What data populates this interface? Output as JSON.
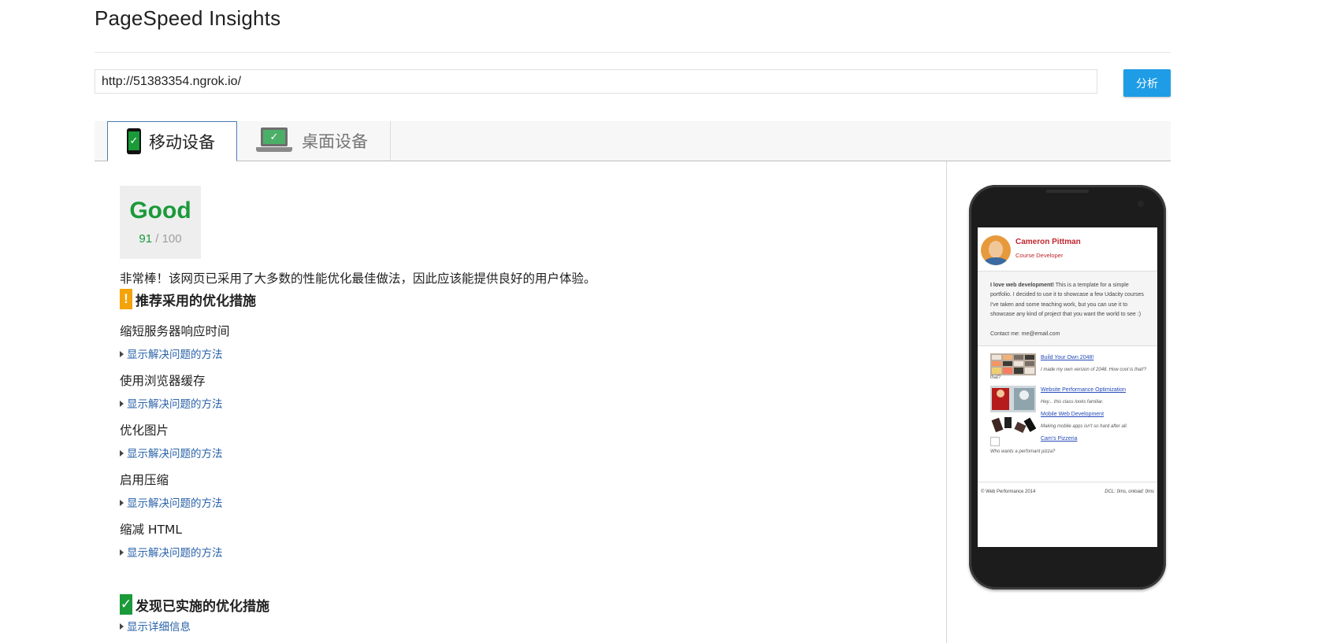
{
  "app": {
    "title": "PageSpeed Insights"
  },
  "search": {
    "value": "http://51383354.ngrok.io/",
    "button_label": "分析"
  },
  "tabs": [
    {
      "label": "移动设备",
      "icon": "phone-check-icon",
      "active": true
    },
    {
      "label": "桌面设备",
      "icon": "laptop-check-icon",
      "active": false
    }
  ],
  "score": {
    "label": "Good",
    "value": "91",
    "separator": " / ",
    "max": "100",
    "color": "#1a9a39"
  },
  "summary": "非常棒！该网页已采用了大多数的性能优化最佳做法，因此应该能提供良好的用户体验。",
  "sections": {
    "recommended": {
      "icon_glyph": "!",
      "title": "推荐采用的优化措施",
      "color": "#f4a30a",
      "rules": [
        {
          "title": "缩短服务器响应时间",
          "link": "显示解决问题的方法"
        },
        {
          "title": "使用浏览器缓存",
          "link": "显示解决问题的方法"
        },
        {
          "title": "优化图片",
          "link": "显示解决问题的方法"
        },
        {
          "title": "启用压缩",
          "link": "显示解决问题的方法"
        },
        {
          "title": "缩减 HTML",
          "link": "显示解决问题的方法"
        }
      ]
    },
    "passed": {
      "icon_glyph": "✓",
      "title": "发现已实施的优化措施",
      "color": "#1a9a39",
      "link": "显示详细信息"
    }
  },
  "preview": {
    "name": "Cameron Pittman",
    "role": "Course Developer",
    "about_bold": "I love web development!",
    "about_text": " This is a template for a simple portfolio. I decided to use it to showcase a few Udacity courses I've taken and some teaching work, but you can use it to showcase any kind of project that you want the world to see :)",
    "contact": "Contact me: me@email.com",
    "projects": [
      {
        "title": "Build Your Own 2048!",
        "desc": "I made my own version of 2048. How cool is that!?"
      },
      {
        "title": "Website Performance Optimization",
        "desc": "Hey... this class looks familiar."
      },
      {
        "title": "Mobile Web Development",
        "desc": "Making mobile apps isn't so hard after all."
      },
      {
        "title": "Cam's Pizzeria",
        "desc": "Who wants a perfomant pizza?"
      }
    ],
    "footer_left": "© Web Performance 2014",
    "footer_right": "DCL: 0ms, onload: 0ms"
  }
}
